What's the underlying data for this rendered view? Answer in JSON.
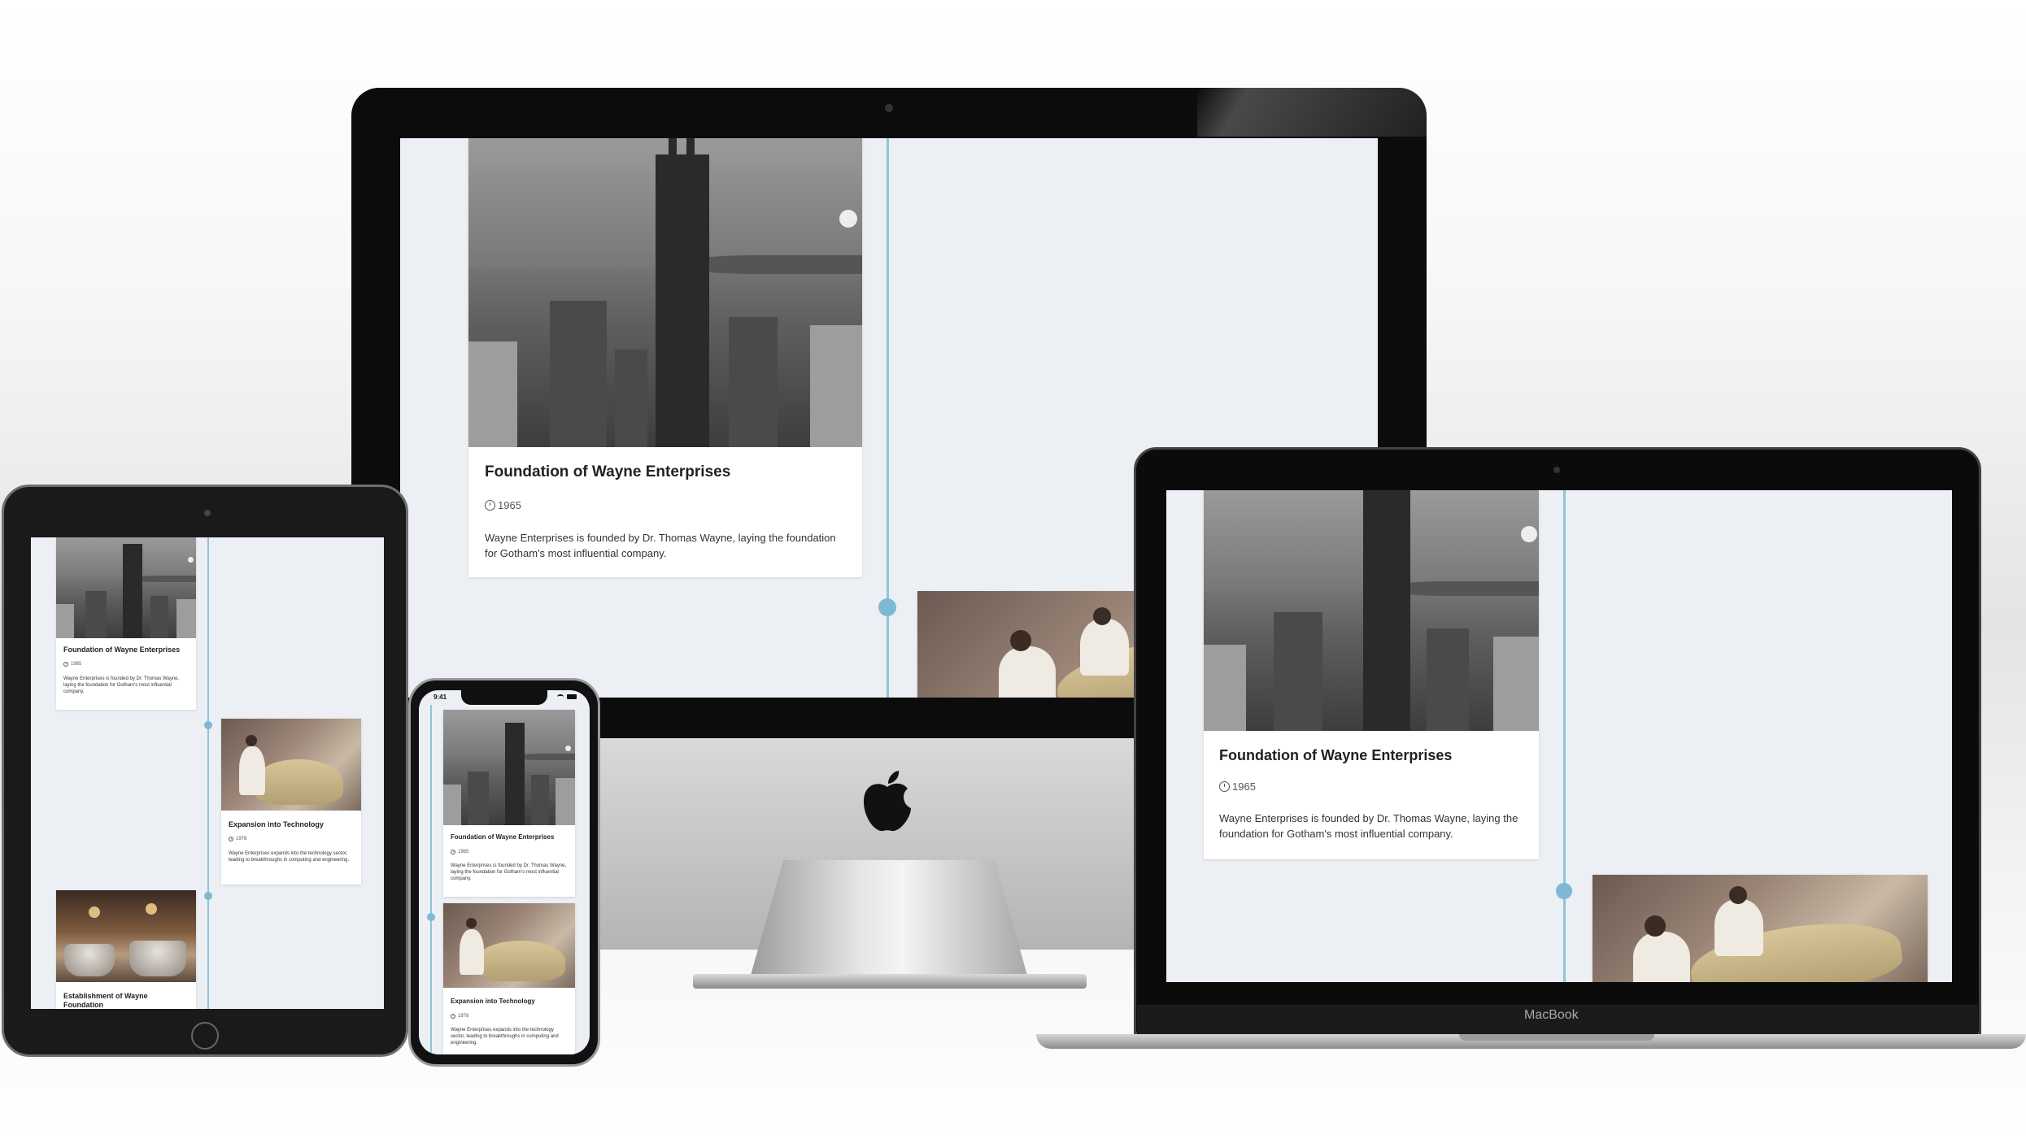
{
  "timeline": {
    "events": [
      {
        "title": "Foundation of Wayne Enterprises",
        "year": "1965",
        "description": "Wayne Enterprises is founded by Dr. Thomas Wayne, laying the foundation for Gotham's most influential company."
      },
      {
        "title": "Expansion into Technology",
        "year": "1978",
        "description": "Wayne Enterprises expands into the technology sector, leading to breakthroughs in computing and engineering."
      },
      {
        "title": "Establishment of Wayne Foundation",
        "year": "",
        "description": ""
      }
    ]
  },
  "devices": {
    "laptop_label": "MacBook",
    "phone_time": "9:41"
  },
  "colors": {
    "timeline_accent": "#7fb8d3",
    "screen_bg": "#eceff3"
  }
}
